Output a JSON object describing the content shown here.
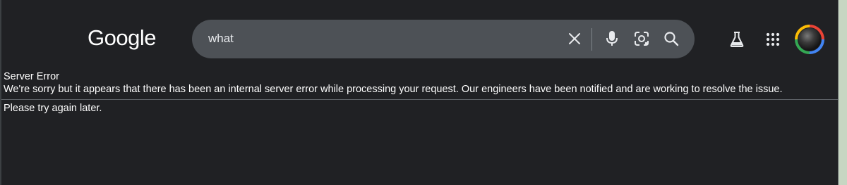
{
  "header": {
    "logo_text": "Google",
    "search": {
      "query": "what"
    },
    "icons": {
      "clear": "close-icon",
      "mic": "microphone-icon",
      "lens": "lens-camera-icon",
      "search": "search-icon",
      "labs": "labs-flask-icon",
      "apps": "apps-grid-icon"
    }
  },
  "error": {
    "title": "Server Error",
    "message": "We're sorry but it appears that there has been an internal server error while processing your request. Our engineers have been notified and are working to resolve the issue.",
    "retry": "Please try again later."
  },
  "colors": {
    "page_background": "#202124",
    "search_box": "#4d5156",
    "text": "#ffffff",
    "icon": "#e8eaed"
  }
}
